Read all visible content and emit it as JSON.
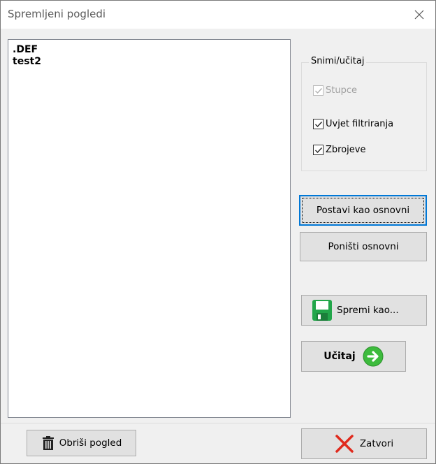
{
  "window": {
    "title": "Spremljeni pogledi"
  },
  "list": {
    "items": [
      ".DEF",
      "test2"
    ]
  },
  "group": {
    "legend": "Snimi/učitaj",
    "checks": [
      {
        "label": "Stupce",
        "checked": true,
        "enabled": false
      },
      {
        "label": "Uvjet filtriranja",
        "checked": true,
        "enabled": true
      },
      {
        "label": "Zbrojeve",
        "checked": true,
        "enabled": true
      }
    ]
  },
  "buttons": {
    "set_default": "Postavi kao osnovni",
    "reset_default": "Poništi osnovni",
    "save_as": "Spremi kao...",
    "load": "Učitaj",
    "delete_view": "Obriši pogled",
    "close": "Zatvori"
  },
  "colors": {
    "accent": "#0078d7",
    "save_icon": "#22a64a",
    "load_icon": "#3dbb3d",
    "close_icon": "#e02a1d"
  },
  "icons": {
    "close": "close-icon",
    "save": "floppy-disk-icon",
    "load": "arrow-right-circle-icon",
    "delete": "trash-can-icon",
    "close_x": "red-x-icon"
  }
}
